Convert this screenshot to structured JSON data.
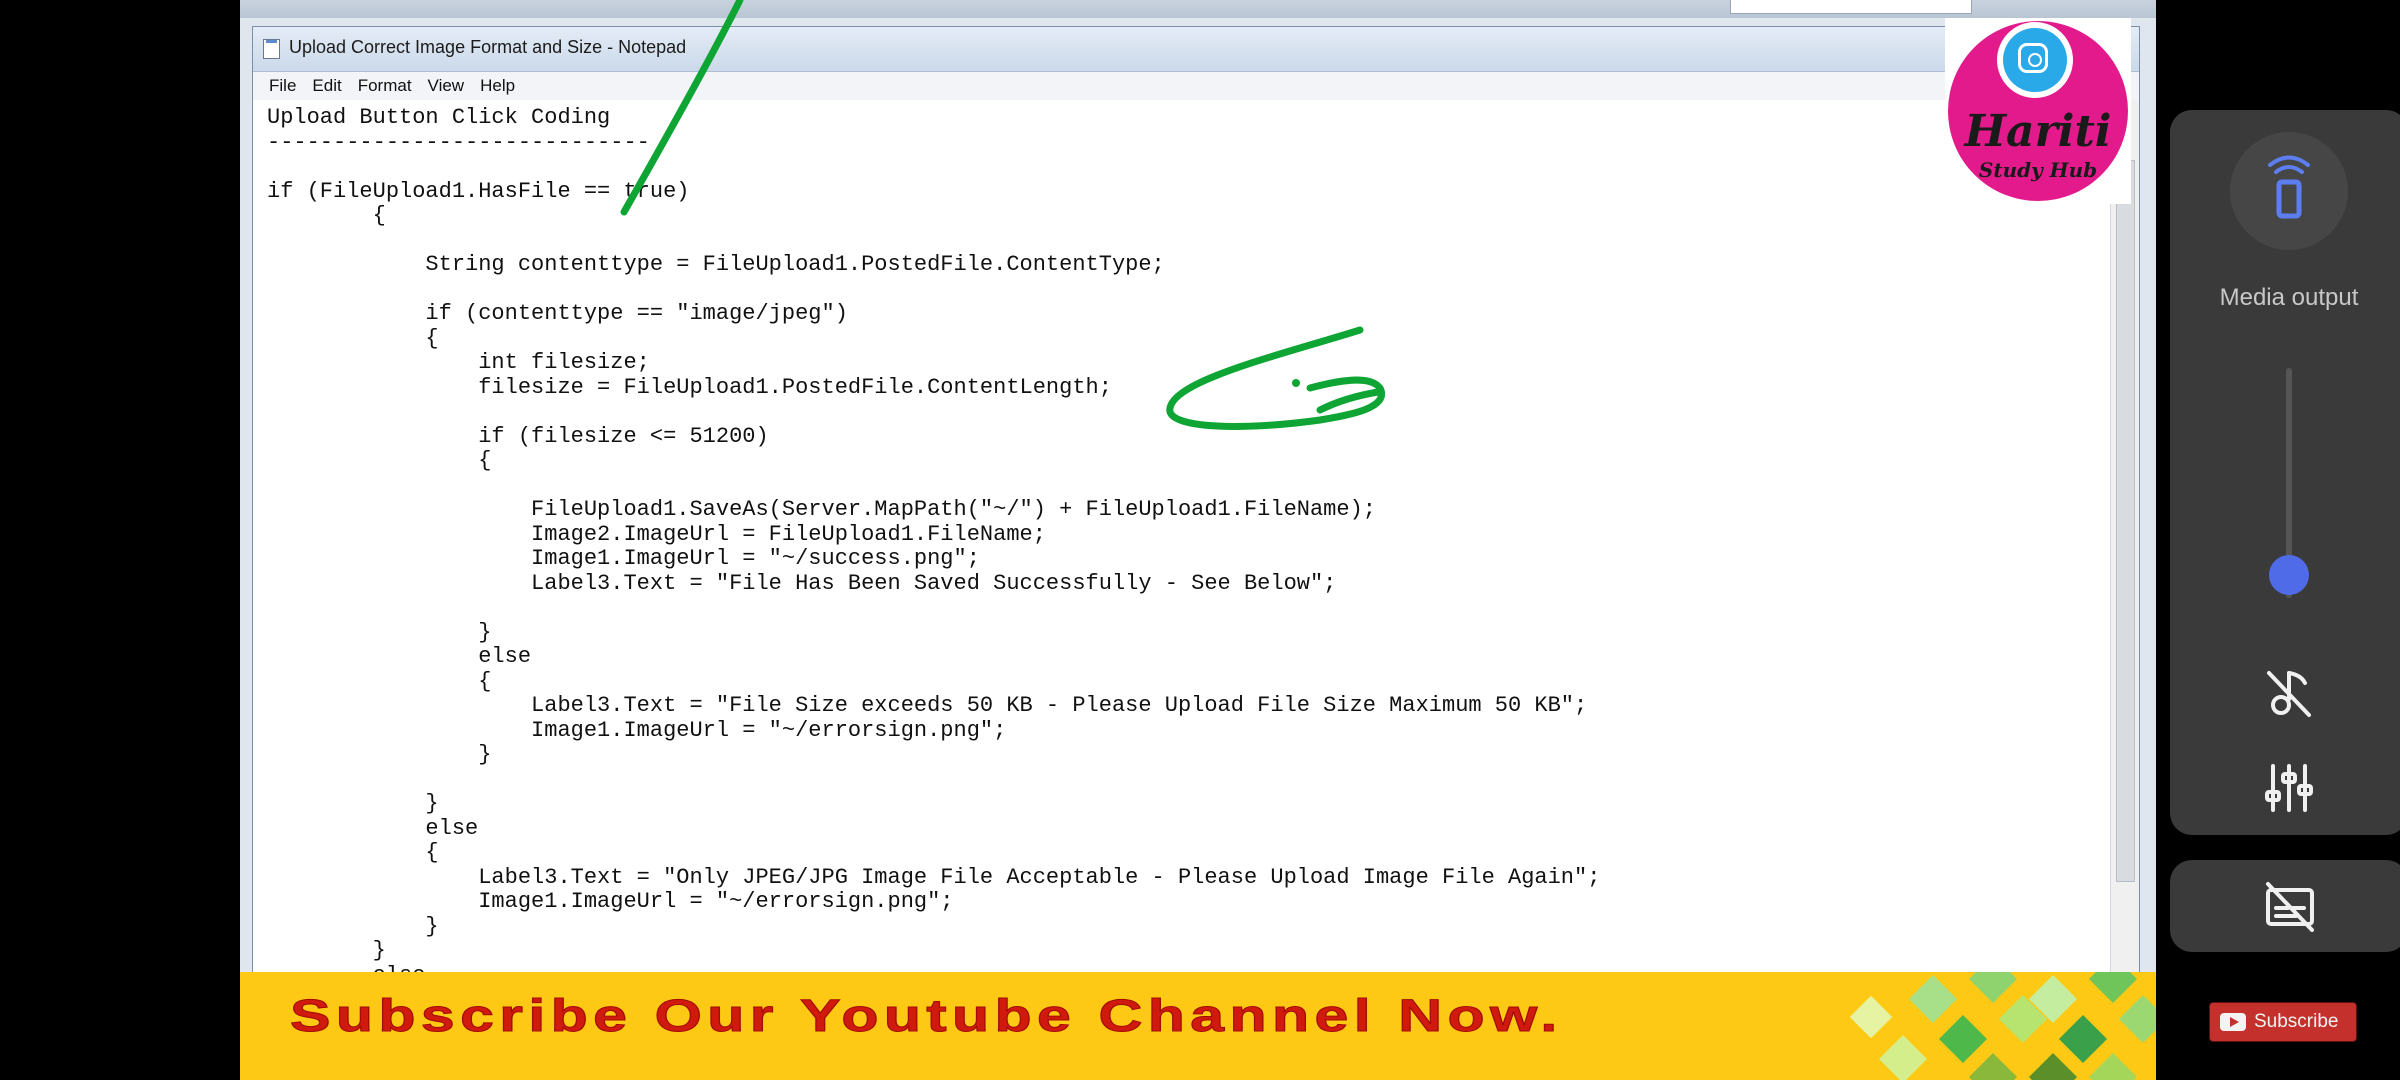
{
  "notepad": {
    "title": "Upload Correct Image Format and Size - Notepad",
    "menu": [
      "File",
      "Edit",
      "Format",
      "View",
      "Help"
    ],
    "content": "Upload Button Click Coding\n-----------------------------\n\nif (FileUpload1.HasFile == true)\n        {\n\n            String contenttype = FileUpload1.PostedFile.ContentType;\n\n            if (contenttype == \"image/jpeg\")\n            {\n                int filesize;\n                filesize = FileUpload1.PostedFile.ContentLength;\n\n                if (filesize <= 51200)\n                {\n\n                    FileUpload1.SaveAs(Server.MapPath(\"~/\") + FileUpload1.FileName);\n                    Image2.ImageUrl = FileUpload1.FileName;\n                    Image1.ImageUrl = \"~/success.png\";\n                    Label3.Text = \"File Has Been Saved Successfully - See Below\";\n\n                }\n                else\n                {\n                    Label3.Text = \"File Size exceeds 50 KB - Please Upload File Size Maximum 50 KB\";\n                    Image1.ImageUrl = \"~/errorsign.png\";\n                }\n\n            }\n            else\n            {\n                Label3.Text = \"Only JPEG/JPG Image File Acceptable - Please Upload Image File Again\";\n                Image1.ImageUrl = \"~/errorsign.png\";\n            }\n        }\n        else"
  },
  "logo": {
    "brand": "Hariti",
    "sub": "Study Hub"
  },
  "banner": {
    "text": "Subscribe Our Youtube Channel Now."
  },
  "volume_panel": {
    "media_label": "Media output",
    "volume_level": 0.1,
    "icons": [
      "media-output-icon",
      "mute-icon",
      "equalizer-icon"
    ]
  },
  "caption_panel": {
    "icons": [
      "captions-off-icon"
    ]
  },
  "subscribe_button": {
    "label": "Subscribe"
  },
  "colors": {
    "annotation": "#0ea534",
    "banner": "#fec914",
    "banner_text": "#d11a0e",
    "logo": "#e21a8c",
    "slider": "#4f6be8",
    "subscribe": "#c4302b"
  }
}
